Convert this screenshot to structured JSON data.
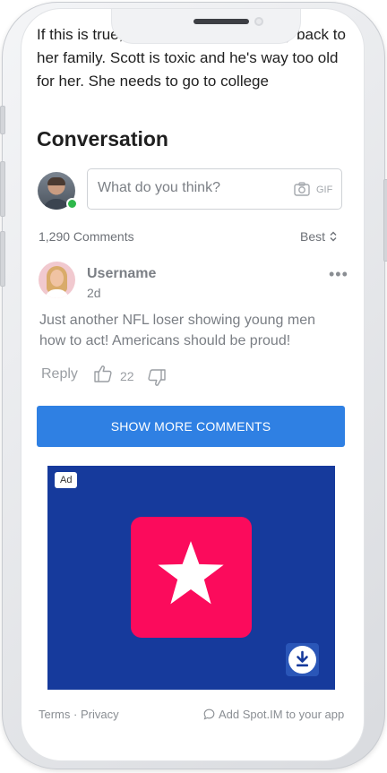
{
  "article": {
    "text": "If this is true, I hope she finds her way back to her family.   Scott is toxic and he's way too old for her.  She needs to go to college"
  },
  "conversation": {
    "title": "Conversation",
    "input_placeholder": "What do you think?",
    "gif_label": "GIF",
    "comment_count": "1,290 Comments",
    "sort_label": "Best"
  },
  "comment": {
    "username": "Username",
    "time": "2d",
    "text": "Just another NFL loser showing young men how to act! Americans should be proud!",
    "reply_label": "Reply",
    "likes": "22"
  },
  "show_more_label": "SHOW MORE COMMENTS",
  "ad": {
    "badge": "Ad",
    "tile_color": "#fb0b5c",
    "background_color": "#163a9c"
  },
  "footer": {
    "terms": "Terms",
    "separator": "·",
    "privacy": "Privacy",
    "spot_label": "Add Spot.IM to your app"
  },
  "colors": {
    "accent": "#2f80e3",
    "online": "#2eb84b"
  }
}
